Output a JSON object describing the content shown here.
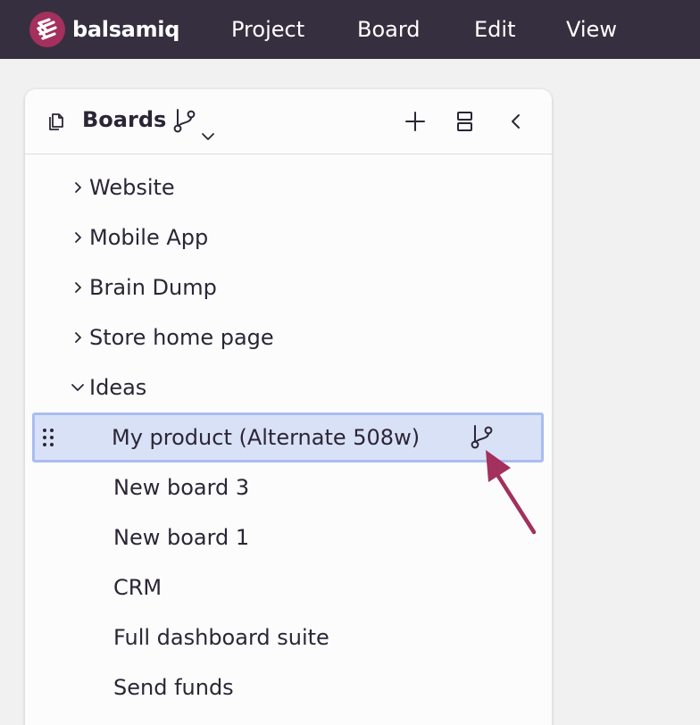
{
  "app": {
    "name": "balsamiq",
    "brand_color": "#a3305d",
    "bar_color": "#362f3f"
  },
  "menu": [
    {
      "label": "Project"
    },
    {
      "label": "Board"
    },
    {
      "label": "Edit"
    },
    {
      "label": "View"
    }
  ],
  "panel": {
    "title": "Boards",
    "icons": [
      "boards-copy-icon",
      "branch-icon",
      "chevron-down-icon",
      "plus-icon",
      "split-view-icon",
      "chevron-left-icon"
    ]
  },
  "tree": {
    "folders": [
      {
        "label": "Website",
        "expanded": false
      },
      {
        "label": "Mobile App",
        "expanded": false
      },
      {
        "label": "Brain Dump",
        "expanded": false
      },
      {
        "label": "Store home page",
        "expanded": false
      },
      {
        "label": "Ideas",
        "expanded": true
      }
    ],
    "selected": {
      "label": "My product (Alternate 508w)",
      "badge_icon": "branch-icon",
      "selection_color": "#d9e1f7"
    },
    "children": [
      {
        "label": "New board 3"
      },
      {
        "label": "New board 1"
      },
      {
        "label": "CRM"
      },
      {
        "label": "Full dashboard suite"
      },
      {
        "label": "Send funds"
      }
    ]
  },
  "annotation": {
    "icon": "arrow-pointer-icon",
    "color": "#a3305d"
  }
}
